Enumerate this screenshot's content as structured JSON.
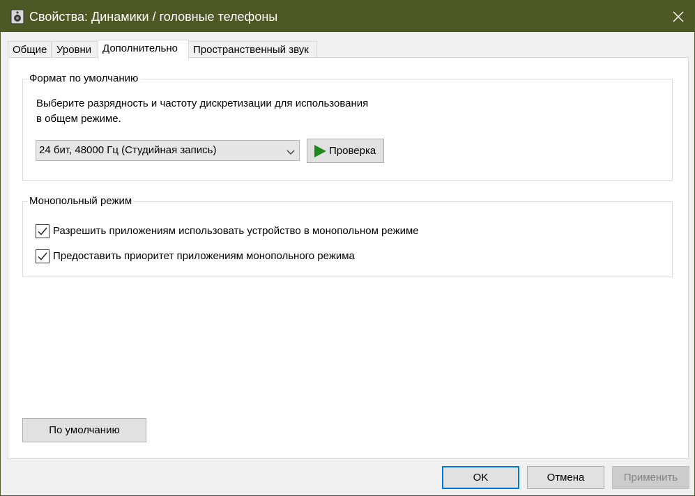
{
  "window": {
    "title": "Свойства: Динамики / головные телефоны",
    "title_icon": "speaker-icon",
    "close_icon": "close-icon",
    "titlebar_color": "#4d5824"
  },
  "tabs": [
    {
      "label": "Общие",
      "active": false
    },
    {
      "label": "Уровни",
      "active": false
    },
    {
      "label": "Дополнительно",
      "active": true
    },
    {
      "label": "Пространственный звук",
      "active": false
    }
  ],
  "default_format": {
    "legend": "Формат по умолчанию",
    "description_line1": "Выберите разрядность и частоту дискретизации для использования",
    "description_line2": "в общем режиме.",
    "selected_format": "24 бит, 48000 Гц (Студийная запись)",
    "test_button_label": "Проверка",
    "test_icon": "play-icon",
    "play_color": "#1e8a1e"
  },
  "exclusive_mode": {
    "legend": "Монопольный режим",
    "options": [
      {
        "label": "Разрешить приложениям использовать устройство в монопольном режиме",
        "checked": true
      },
      {
        "label": "Предоставить приоритет приложениям монопольного режима",
        "checked": true
      }
    ]
  },
  "restore_defaults_label": "По умолчанию",
  "footer": {
    "ok_label": "OK",
    "cancel_label": "Отмена",
    "apply_label": "Применить",
    "apply_enabled": false,
    "accent_color": "#0078d7"
  }
}
